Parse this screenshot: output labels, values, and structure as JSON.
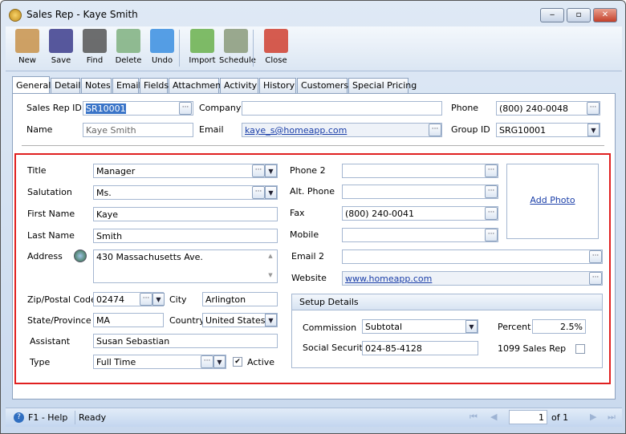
{
  "window": {
    "title": "Sales Rep - Kaye Smith",
    "minimize": "‒",
    "maximize": "▫",
    "close": "✕"
  },
  "toolbar": [
    {
      "label": "New",
      "icon": "new-icon",
      "color": "#c8924a"
    },
    {
      "label": "Save",
      "icon": "save-icon",
      "color": "#3c3c8c"
    },
    {
      "label": "Find",
      "icon": "find-icon",
      "color": "#555"
    },
    {
      "label": "Delete",
      "icon": "delete-icon",
      "color": "#7fb07f"
    },
    {
      "label": "Undo",
      "icon": "undo-icon",
      "color": "#3a8ee0"
    },
    {
      "label": "Import",
      "icon": "import-icon",
      "color": "#6ab04c"
    },
    {
      "label": "Schedule",
      "icon": "schedule-icon",
      "color": "#8a9a7a"
    },
    {
      "label": "Close",
      "icon": "close-icon",
      "color": "#d04030"
    }
  ],
  "tabs": [
    "General",
    "Detail",
    "Notes",
    "Email",
    "Fields",
    "Attachment",
    "Activity",
    "History",
    "Customers",
    "Special Pricing"
  ],
  "header": {
    "sales_rep_id_label": "Sales Rep ID",
    "sales_rep_id": "SR10001",
    "company_label": "Company",
    "company": "",
    "phone_label": "Phone",
    "phone": "(800) 240-0048",
    "name_label": "Name",
    "name": "Kaye Smith",
    "email_label": "Email",
    "email": "kaye_s@homeapp.com",
    "group_id_label": "Group ID",
    "group_id": "SRG10001"
  },
  "details": {
    "title_label": "Title",
    "title": "Manager",
    "salutation_label": "Salutation",
    "salutation": "Ms.",
    "first_name_label": "First Name",
    "first_name": "Kaye",
    "last_name_label": "Last Name",
    "last_name": "Smith",
    "address_label": "Address",
    "address": "430 Massachusetts Ave.",
    "zip_label": "Zip/Postal Code",
    "zip": "02474",
    "city_label": "City",
    "city": "Arlington",
    "state_label": "State/Province",
    "state": "MA",
    "country_label": "Country",
    "country": "United States",
    "assistant_label": "Assistant",
    "assistant": "Susan Sebastian",
    "type_label": "Type",
    "type": "Full Time",
    "active_label": "Active",
    "active": true,
    "phone2_label": "Phone 2",
    "phone2": "",
    "alt_phone_label": "Alt. Phone",
    "alt_phone": "",
    "fax_label": "Fax",
    "fax": "(800) 240-0041",
    "mobile_label": "Mobile",
    "mobile": "",
    "email2_label": "Email 2",
    "email2": "",
    "website_label": "Website",
    "website": "www.homeapp.com",
    "add_photo": "Add Photo"
  },
  "setup": {
    "title": "Setup Details",
    "commission_label": "Commission",
    "commission": "Subtotal",
    "percent_label": "Percent",
    "percent": "2.5%",
    "ssn_label": "Social Security",
    "ssn": "024-85-4128",
    "sales_rep_1099_label": "1099 Sales Rep",
    "sales_rep_1099": false
  },
  "status": {
    "help": "F1 - Help",
    "state": "Ready",
    "page": "1",
    "of": "of 1"
  }
}
